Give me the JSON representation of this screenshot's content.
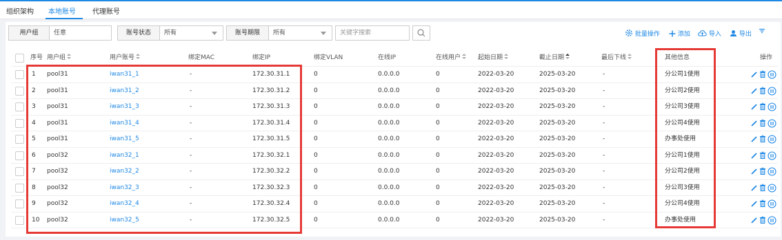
{
  "tabs": [
    {
      "label": "组织架构",
      "active": false
    },
    {
      "label": "本地账号",
      "active": true
    },
    {
      "label": "代理账号",
      "active": false
    }
  ],
  "filters": {
    "user_group_label": "用户组",
    "user_group_value": "任意",
    "status_label": "账号状态",
    "status_value": "所有",
    "period_label": "账号期限",
    "period_value": "所有",
    "search_placeholder": "关键字搜索"
  },
  "toolbar": {
    "batch": "批量操作",
    "add": "添加",
    "import": "导入",
    "export": "导出"
  },
  "columns": {
    "no": "序号",
    "group": "用户组",
    "account": "用户账号",
    "mac": "绑定MAC",
    "ip": "绑定IP",
    "vlan": "绑定VLAN",
    "online_ip": "在线IP",
    "online_user": "在线用户",
    "start": "起始日期",
    "end": "截止日期",
    "last_offline": "最后下线",
    "other": "其他信息",
    "action": "操作"
  },
  "rows": [
    {
      "no": "1",
      "group": "pool31",
      "account": "iwan31_1",
      "mac": "-",
      "ip": "172.30.31.1",
      "vlan": "0",
      "online_ip": "0.0.0.0",
      "online_user": "0",
      "start": "2022-03-20",
      "end": "2025-03-20",
      "last_offline": "-",
      "other": "分公司1使用"
    },
    {
      "no": "2",
      "group": "pool31",
      "account": "iwan31_2",
      "mac": "-",
      "ip": "172.30.31.2",
      "vlan": "0",
      "online_ip": "0.0.0.0",
      "online_user": "0",
      "start": "2022-03-20",
      "end": "2025-03-20",
      "last_offline": "-",
      "other": "分公司2使用"
    },
    {
      "no": "3",
      "group": "pool31",
      "account": "iwan31_3",
      "mac": "-",
      "ip": "172.30.31.3",
      "vlan": "0",
      "online_ip": "0.0.0.0",
      "online_user": "0",
      "start": "2022-03-20",
      "end": "2025-03-20",
      "last_offline": "-",
      "other": "分公司3使用"
    },
    {
      "no": "4",
      "group": "pool31",
      "account": "iwan31_4",
      "mac": "-",
      "ip": "172.30.31.4",
      "vlan": "0",
      "online_ip": "0.0.0.0",
      "online_user": "0",
      "start": "2022-03-20",
      "end": "2025-03-20",
      "last_offline": "-",
      "other": "分公司4使用"
    },
    {
      "no": "5",
      "group": "pool31",
      "account": "iwan31_5",
      "mac": "-",
      "ip": "172.30.31.5",
      "vlan": "0",
      "online_ip": "0.0.0.0",
      "online_user": "0",
      "start": "2022-03-20",
      "end": "2025-03-20",
      "last_offline": "-",
      "other": "办事处使用"
    },
    {
      "no": "6",
      "group": "pool32",
      "account": "iwan32_1",
      "mac": "-",
      "ip": "172.30.32.1",
      "vlan": "0",
      "online_ip": "0.0.0.0",
      "online_user": "0",
      "start": "2022-03-20",
      "end": "2025-03-20",
      "last_offline": "-",
      "other": "分公司1使用"
    },
    {
      "no": "7",
      "group": "pool32",
      "account": "iwan32_2",
      "mac": "-",
      "ip": "172.30.32.2",
      "vlan": "0",
      "online_ip": "0.0.0.0",
      "online_user": "0",
      "start": "2022-03-20",
      "end": "2025-03-20",
      "last_offline": "-",
      "other": "分公司2使用"
    },
    {
      "no": "8",
      "group": "pool32",
      "account": "iwan32_3",
      "mac": "-",
      "ip": "172.30.32.3",
      "vlan": "0",
      "online_ip": "0.0.0.0",
      "online_user": "0",
      "start": "2022-03-20",
      "end": "2025-03-20",
      "last_offline": "-",
      "other": "分公司3使用"
    },
    {
      "no": "9",
      "group": "pool32",
      "account": "iwan32_4",
      "mac": "-",
      "ip": "172.30.32.4",
      "vlan": "0",
      "online_ip": "0.0.0.0",
      "online_user": "0",
      "start": "2022-03-20",
      "end": "2025-03-20",
      "last_offline": "-",
      "other": "分公司4使用"
    },
    {
      "no": "10",
      "group": "pool32",
      "account": "iwan32_5",
      "mac": "-",
      "ip": "172.30.32.5",
      "vlan": "0",
      "online_ip": "0.0.0.0",
      "online_user": "0",
      "start": "2022-03-20",
      "end": "2025-03-20",
      "last_offline": "-",
      "other": "办事处使用"
    }
  ],
  "colors": {
    "accent": "#1e88e5",
    "highlight": "#e53935"
  }
}
